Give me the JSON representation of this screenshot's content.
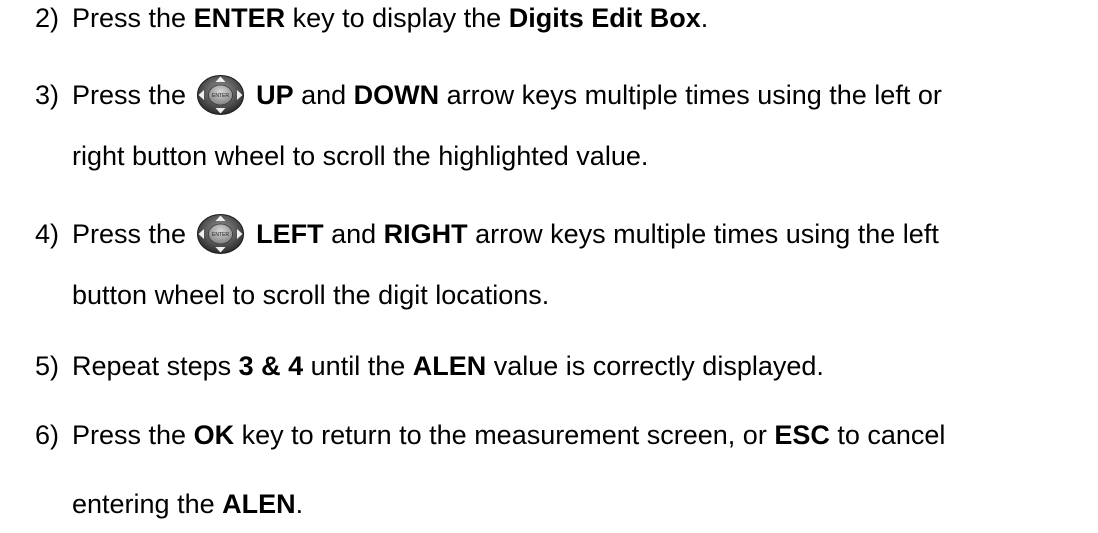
{
  "steps": [
    {
      "num": "2)",
      "lines": [
        [
          {
            "t": "Press the "
          },
          {
            "b": "ENTER"
          },
          {
            "t": " key to display the "
          },
          {
            "b": "Digits Edit Box"
          },
          {
            "t": "."
          }
        ]
      ]
    },
    {
      "num": "3)",
      "lines": [
        [
          {
            "t": "Press the "
          },
          {
            "icon": "enter-arrow-pad-icon"
          },
          {
            "t": " "
          },
          {
            "b": "UP"
          },
          {
            "t": " and "
          },
          {
            "b": "DOWN"
          },
          {
            "t": " arrow keys multiple times using the left or"
          }
        ],
        [
          {
            "t": "right button wheel to scroll the highlighted value."
          }
        ]
      ]
    },
    {
      "num": "4)",
      "lines": [
        [
          {
            "t": "Press the "
          },
          {
            "icon": "enter-arrow-pad-icon"
          },
          {
            "t": " "
          },
          {
            "b": "LEFT"
          },
          {
            "t": " and "
          },
          {
            "b": "RIGHT"
          },
          {
            "t": " arrow keys multiple times using the left"
          }
        ],
        [
          {
            "t": "button wheel to scroll the digit locations."
          }
        ]
      ]
    },
    {
      "num": "5)",
      "lines": [
        [
          {
            "t": "Repeat steps "
          },
          {
            "b": "3 & 4"
          },
          {
            "t": " until the "
          },
          {
            "b": "ALEN"
          },
          {
            "t": " value is correctly displayed."
          }
        ]
      ]
    },
    {
      "num": "6)",
      "lines": [
        [
          {
            "t": "Press the "
          },
          {
            "b": "OK"
          },
          {
            "t": " key to return to the measurement screen, or "
          },
          {
            "b": "ESC"
          },
          {
            "t": " to cancel"
          }
        ],
        [
          {
            "t": "entering the "
          },
          {
            "b": "ALEN"
          },
          {
            "t": "."
          }
        ]
      ]
    }
  ],
  "icon_label": "ENTER"
}
